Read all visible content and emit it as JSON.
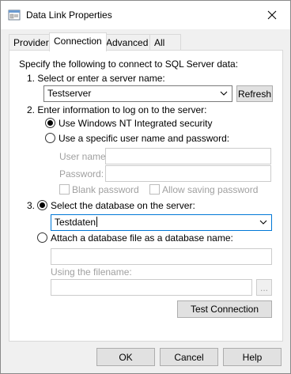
{
  "window": {
    "title": "Data Link Properties"
  },
  "tabs": [
    {
      "label": "Provider",
      "active": false
    },
    {
      "label": "Connection",
      "active": true
    },
    {
      "label": "Advanced",
      "active": false
    },
    {
      "label": "All",
      "active": false
    }
  ],
  "connection": {
    "intro": "Specify the following to connect to SQL Server data:",
    "step1_label": "1. Select or enter a server name:",
    "server_name": "Testserver",
    "refresh_label": "Refresh",
    "step2_label": "2. Enter information to log on to the server:",
    "auth_windows_label": "Use Windows NT Integrated security",
    "auth_specific_label": "Use a specific user name and password:",
    "username_label": "User name:",
    "username_value": "",
    "password_label": "Password:",
    "password_value": "",
    "blank_password_label": "Blank password",
    "allow_saving_label": "Allow saving password",
    "step3_prefix": "3.",
    "select_db_label": "Select the database on the server:",
    "database_name": "Testdaten",
    "attach_db_label": "Attach a database file as a database name:",
    "attach_db_value": "",
    "filename_label": "Using the filename:",
    "filename_value": "",
    "browse_label": "...",
    "test_connection_label": "Test Connection"
  },
  "footer": {
    "ok_label": "OK",
    "cancel_label": "Cancel",
    "help_label": "Help"
  }
}
